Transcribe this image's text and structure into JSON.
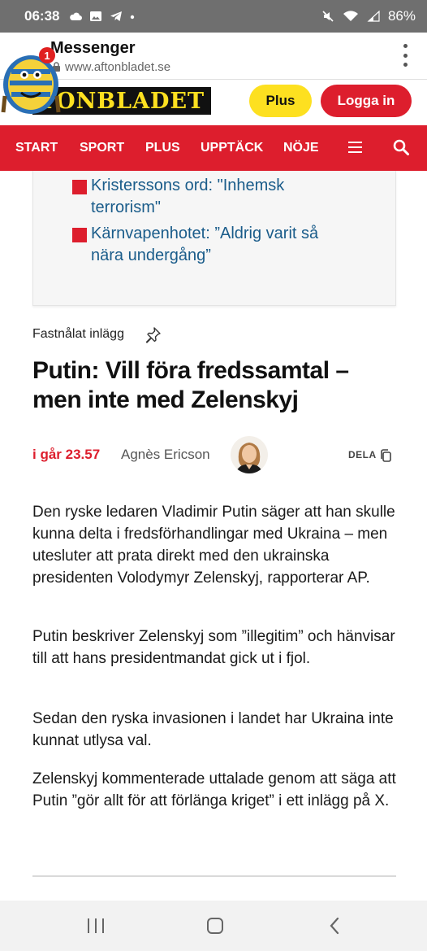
{
  "status_bar": {
    "time": "06:38",
    "battery": "86%",
    "icons": [
      "cloud-icon",
      "image-icon",
      "telegram-icon",
      "dot-icon",
      "mute-icon",
      "wifi-icon",
      "signal-icon",
      "battery-icon"
    ]
  },
  "browser": {
    "title": "Messenger",
    "url": "www.aftonbladet.se",
    "notification_count": "1"
  },
  "site": {
    "logo_text": "TONBLADET",
    "plus_label": "Plus",
    "login_label": "Logga in",
    "colors": {
      "brand_red": "#dd1e2d",
      "brand_yellow": "#fde020",
      "link_blue": "#1a5c8a"
    }
  },
  "nav": {
    "items": [
      "START",
      "SPORT",
      "PLUS",
      "UPPTÄCK",
      "NÖJE"
    ]
  },
  "related": {
    "links": [
      {
        "line1": "Kristerssons ord: \"Inhemsk",
        "line2": "terrorism\""
      },
      {
        "line1": "Kärnvapenhotet: ”Aldrig varit så",
        "line2": "nära undergång”"
      }
    ]
  },
  "post": {
    "pinned_label": "Fastnålat inlägg",
    "headline": "Putin: Vill föra fredssamtal – men inte med Zelenskyj",
    "time": "i går 23.57",
    "author": "Agnès Ericson",
    "share_label": "DELA",
    "paragraphs": [
      "Den ryske ledaren Vladimir Putin säger att han skulle kunna delta i fredsförhandlingar med Ukraina – men utesluter att prata direkt med den ukrainska presidenten Volodymyr Zelenskyj, rapporterar AP.",
      "Putin beskriver Zelenskyj som ”illegitim” och hänvisar till att hans presidentmandat gick ut i fjol.",
      "Sedan den ryska invasionen i landet har Ukraina inte kunnat utlysa val.",
      "Zelenskyj kommenterade uttalade genom att säga att Putin ”gör allt för att förlänga kriget” i ett inlägg på X."
    ]
  }
}
